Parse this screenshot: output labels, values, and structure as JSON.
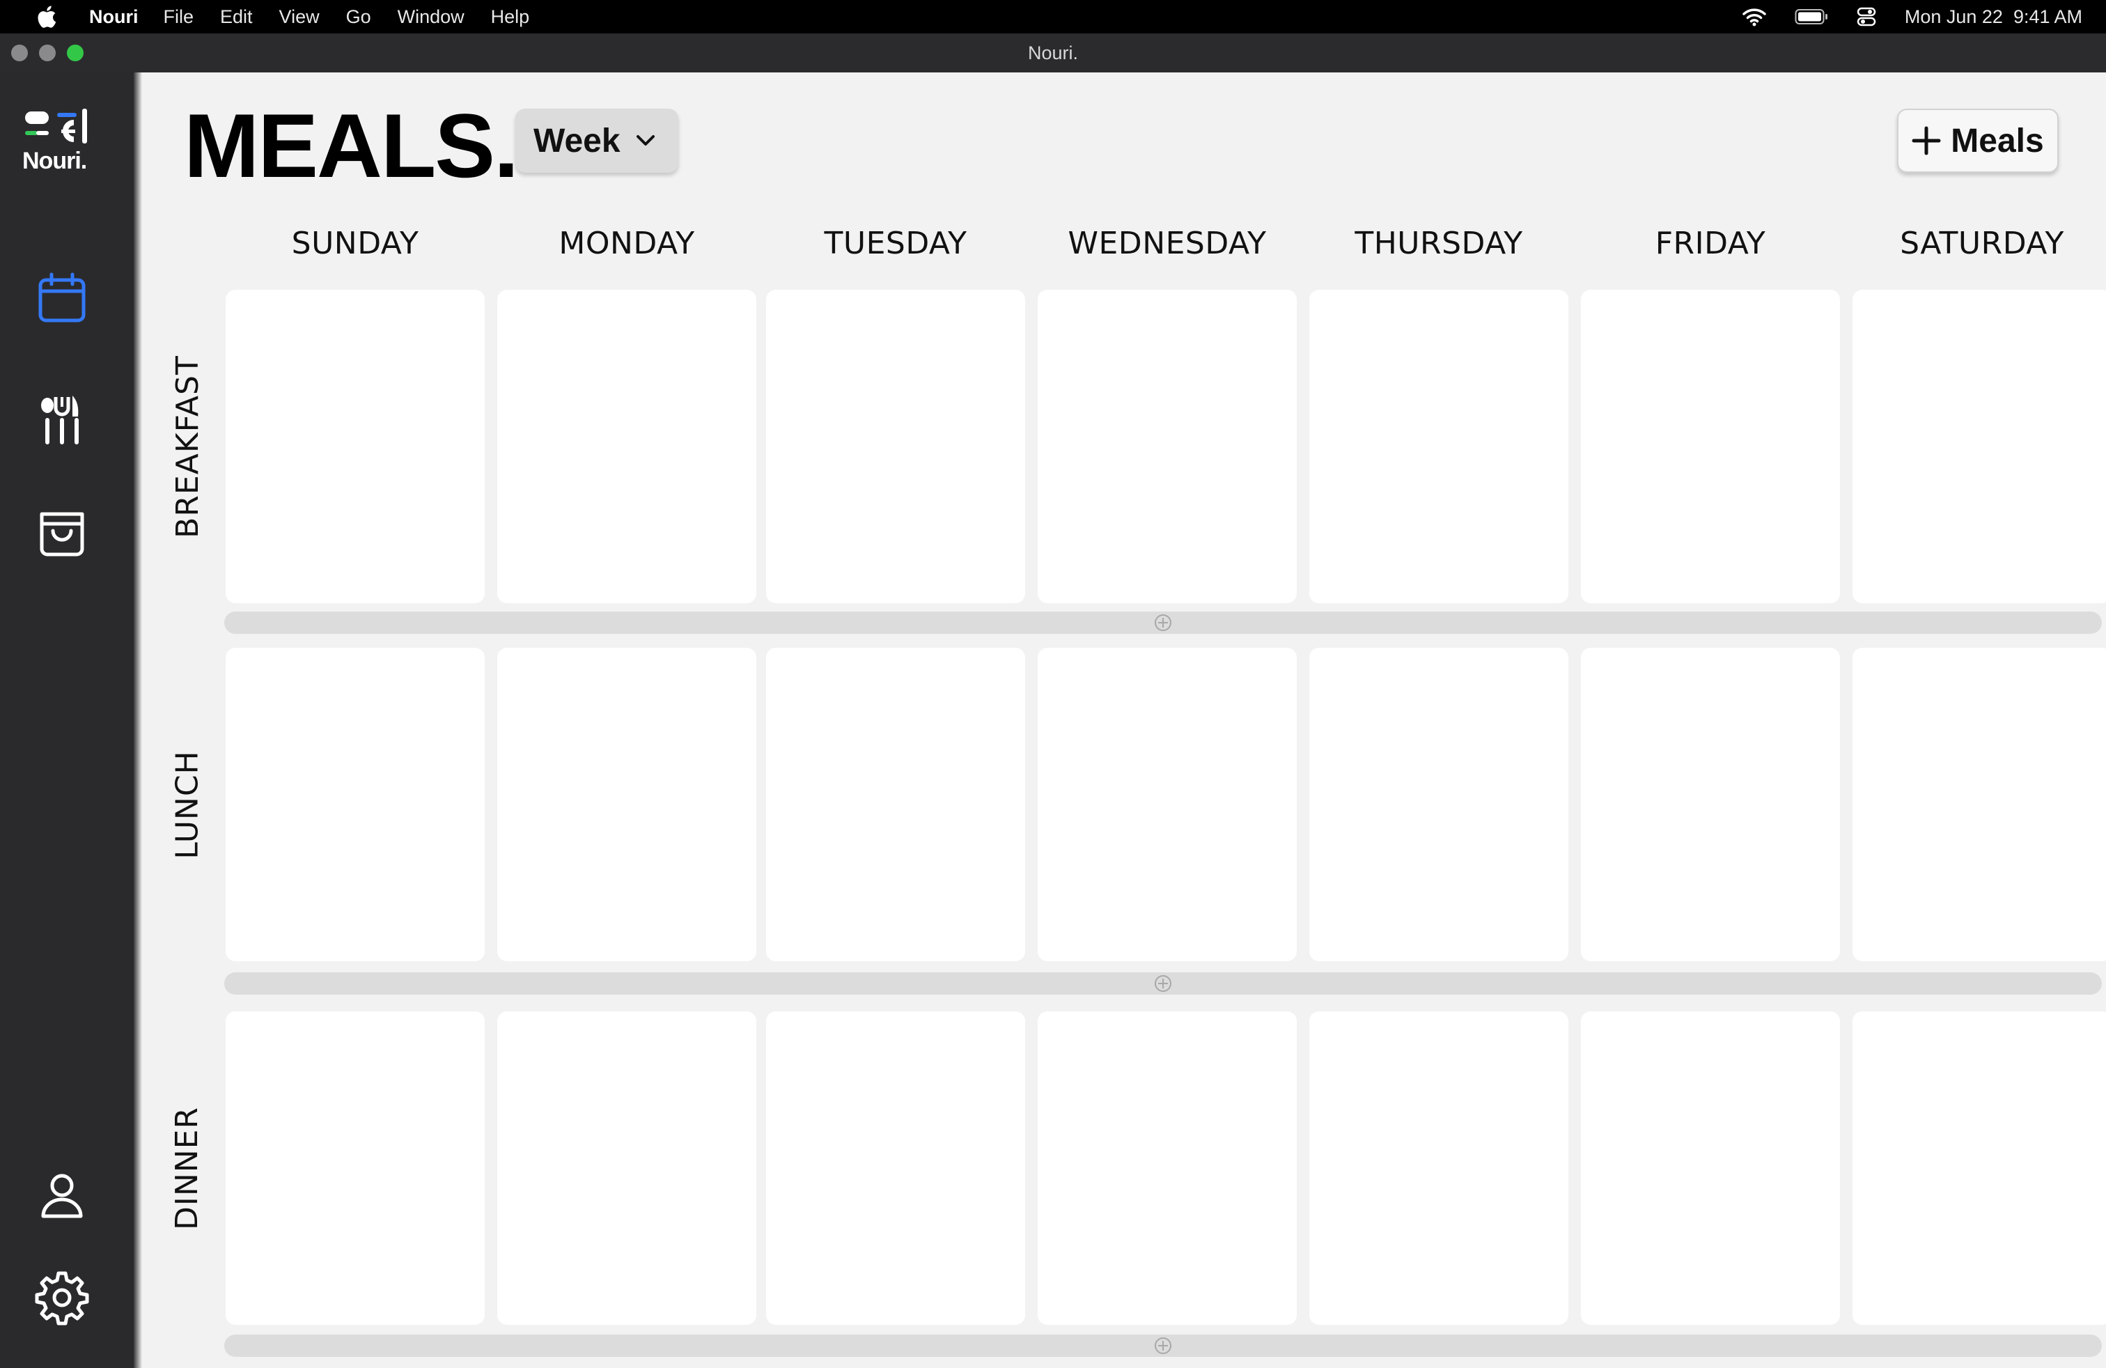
{
  "menubar": {
    "app_name": "Nouri",
    "items": [
      "File",
      "Edit",
      "View",
      "Go",
      "Window",
      "Help"
    ],
    "date": "Mon Jun 22",
    "time": "9:41 AM"
  },
  "window": {
    "title": "Nouri."
  },
  "sidebar": {
    "logo_text": "Nouri.",
    "nav": [
      {
        "name": "calendar",
        "icon": "calendar-icon",
        "active": true
      },
      {
        "name": "meals",
        "icon": "utensils-icon",
        "active": false
      },
      {
        "name": "groceries",
        "icon": "shopping-bag-icon",
        "active": false
      },
      {
        "name": "profile",
        "icon": "user-icon",
        "active": false
      },
      {
        "name": "settings",
        "icon": "gear-icon",
        "active": false
      }
    ],
    "accent_color": "#3478f6"
  },
  "main": {
    "title": "MEALS.",
    "view_select": {
      "value": "Week"
    },
    "add_button_label": "Meals",
    "days": [
      "SUNDAY",
      "MONDAY",
      "TUESDAY",
      "WEDNESDAY",
      "THURSDAY",
      "FRIDAY",
      "SATURDAY"
    ],
    "meals": [
      "BREAKFAST",
      "LUNCH",
      "DINNER"
    ]
  }
}
